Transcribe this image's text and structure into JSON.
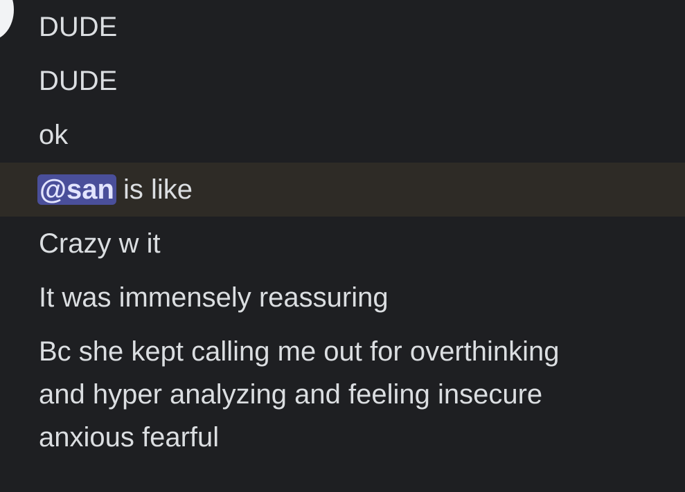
{
  "messages": [
    {
      "text": "DUDE"
    },
    {
      "text": "DUDE"
    },
    {
      "text": "ok"
    },
    {
      "mention": "@san",
      "text": "is like"
    },
    {
      "text": "Crazy w it"
    },
    {
      "text": "It was immensely reassuring"
    },
    {
      "lines": [
        "Bc she kept calling me out for overthinking",
        "and hyper analyzing and feeling insecure",
        "anxious fearful"
      ]
    }
  ],
  "colors": {
    "background": "#1e1f22",
    "highlight_row": "#2e2b26",
    "mention_bg": "#4a4f9a",
    "text": "#dbdee1"
  }
}
